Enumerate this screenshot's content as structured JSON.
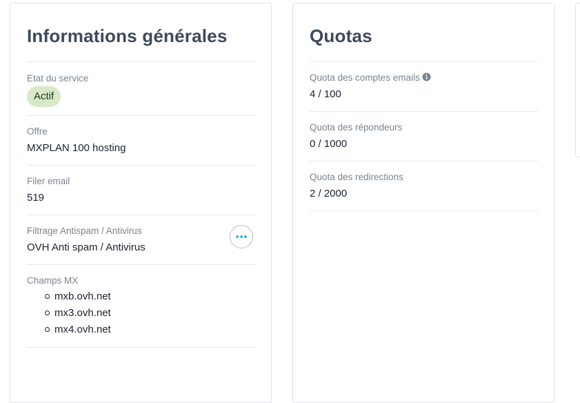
{
  "general": {
    "title": "Informations générales",
    "service_state": {
      "label": "Etat du service",
      "value": "Actif"
    },
    "offer": {
      "label": "Offre",
      "value": "MXPLAN 100 hosting"
    },
    "filer": {
      "label": "Filer email",
      "value": "519"
    },
    "filtering": {
      "label": "Filtrage Antispam / Antivirus",
      "value": "OVH Anti spam / Antivirus",
      "action_icon": "ellipsis-icon"
    },
    "mx": {
      "label": "Champs MX",
      "items": [
        "mxb.ovh.net",
        "mx3.ovh.net",
        "mx4.ovh.net"
      ]
    }
  },
  "quotas": {
    "title": "Quotas",
    "email_accounts": {
      "label": "Quota des comptes emails",
      "value": "4 / 100",
      "icon": "info-icon"
    },
    "responders": {
      "label": "Quota des répondeurs",
      "value": "0 / 1000"
    },
    "redirections": {
      "label": "Quota des redirections",
      "value": "2 / 2000"
    }
  },
  "colors": {
    "badge_bg": "#d9e8c6",
    "accent": "#0a9ec9",
    "title": "#3d4a5c"
  }
}
